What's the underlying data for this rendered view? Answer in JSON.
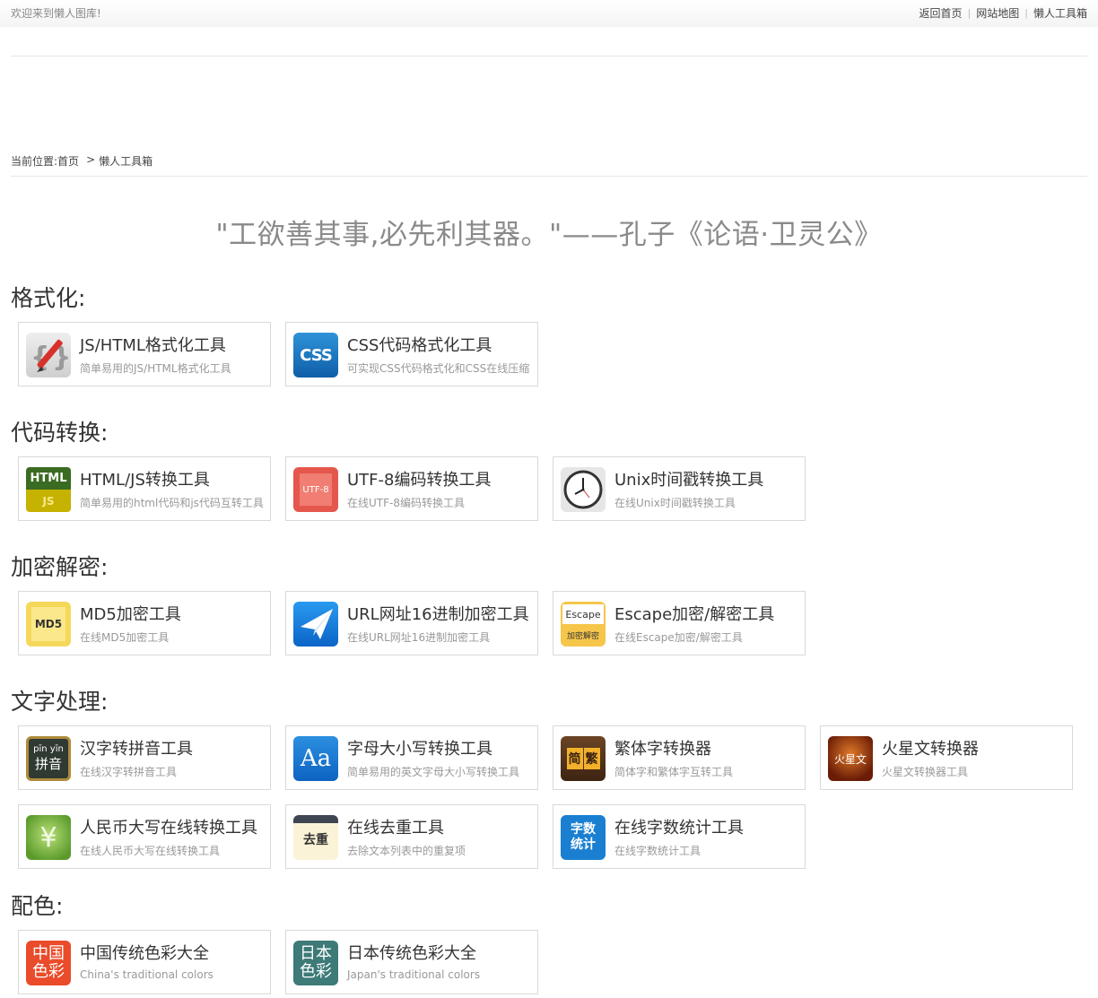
{
  "header": {
    "welcome": "欢迎来到懒人图库!",
    "links": [
      "返回首页",
      "网站地图",
      "懒人工具箱"
    ],
    "sep": "|"
  },
  "breadcrumb": {
    "prefix": "当前位置:",
    "home": "首页",
    "arrow": ">",
    "current": "懒人工具箱"
  },
  "quote": "\"工欲善其事,必先利其器。\"——孔子《论语·卫灵公》",
  "sections": {
    "format": {
      "title": "格式化:",
      "tools": [
        {
          "name": "JS/HTML格式化工具",
          "desc": "简单易用的JS/HTML格式化工具",
          "icon": "pencil-braces-icon",
          "glyph": "{ }"
        },
        {
          "name": "CSS代码格式化工具",
          "desc": "可实现CSS代码格式化和CSS在线压缩",
          "icon": "css-icon",
          "glyph": "CSS"
        }
      ]
    },
    "convert": {
      "title": "代码转换:",
      "tools": [
        {
          "name": "HTML/JS转换工具",
          "desc": "简单易用的html代码和js代码互转工具",
          "icon": "html-js-icon",
          "glyph": "HTML",
          "glyph2": "JS"
        },
        {
          "name": "UTF-8编码转换工具",
          "desc": "在线UTF-8编码转换工具",
          "icon": "utf8-icon",
          "glyph": "UTF-8"
        },
        {
          "name": "Unix时间戳转换工具",
          "desc": "在线Unix时间戳转换工具",
          "icon": "clock-icon",
          "glyph": ""
        }
      ]
    },
    "crypto": {
      "title": "加密解密:",
      "tools": [
        {
          "name": "MD5加密工具",
          "desc": "在线MD5加密工具",
          "icon": "md5-icon",
          "glyph": "MD5"
        },
        {
          "name": "URL网址16进制加密工具",
          "desc": "在线URL网址16进制加密工具",
          "icon": "paper-plane-icon",
          "glyph": ""
        },
        {
          "name": "Escape加密/解密工具",
          "desc": "在线Escape加密/解密工具",
          "icon": "escape-icon",
          "glyph": "Escape",
          "glyph2": "加密解密"
        }
      ]
    },
    "text": {
      "title": "文字处理:",
      "tools": [
        {
          "name": "汉字转拼音工具",
          "desc": "在线汉字转拼音工具",
          "icon": "pinyin-icon",
          "glyph": "pīn yīn",
          "glyph2": "拼音"
        },
        {
          "name": "字母大小写转换工具",
          "desc": "简单易用的英文字母大小写转换工具",
          "icon": "aa-icon",
          "glyph": "Aa"
        },
        {
          "name": "繁体字转换器",
          "desc": "简体字和繁体字互转工具",
          "icon": "traditional-icon",
          "glyph": "简",
          "glyph2": "繁"
        },
        {
          "name": "火星文转换器",
          "desc": "火星文转换器工具",
          "icon": "mars-text-icon",
          "glyph": "火星文"
        },
        {
          "name": "人民币大写在线转换工具",
          "desc": "在线人民币大写在线转换工具",
          "icon": "yen-icon",
          "glyph": "¥"
        },
        {
          "name": "在线去重工具",
          "desc": "去除文本列表中的重复项",
          "icon": "dedupe-icon",
          "glyph": "去重"
        },
        {
          "name": "在线字数统计工具",
          "desc": "在线字数统计工具",
          "icon": "word-count-icon",
          "glyph": "字数",
          "glyph2": "统计"
        }
      ]
    },
    "color": {
      "title": "配色:",
      "tools": [
        {
          "name": "中国传统色彩大全",
          "desc": "China's traditional colors",
          "icon": "china-colors-icon",
          "glyph": "中国",
          "glyph2": "色彩"
        },
        {
          "name": "日本传统色彩大全",
          "desc": "Japan's traditional colors",
          "icon": "japan-colors-icon",
          "glyph": "日本",
          "glyph2": "色彩"
        }
      ]
    }
  }
}
